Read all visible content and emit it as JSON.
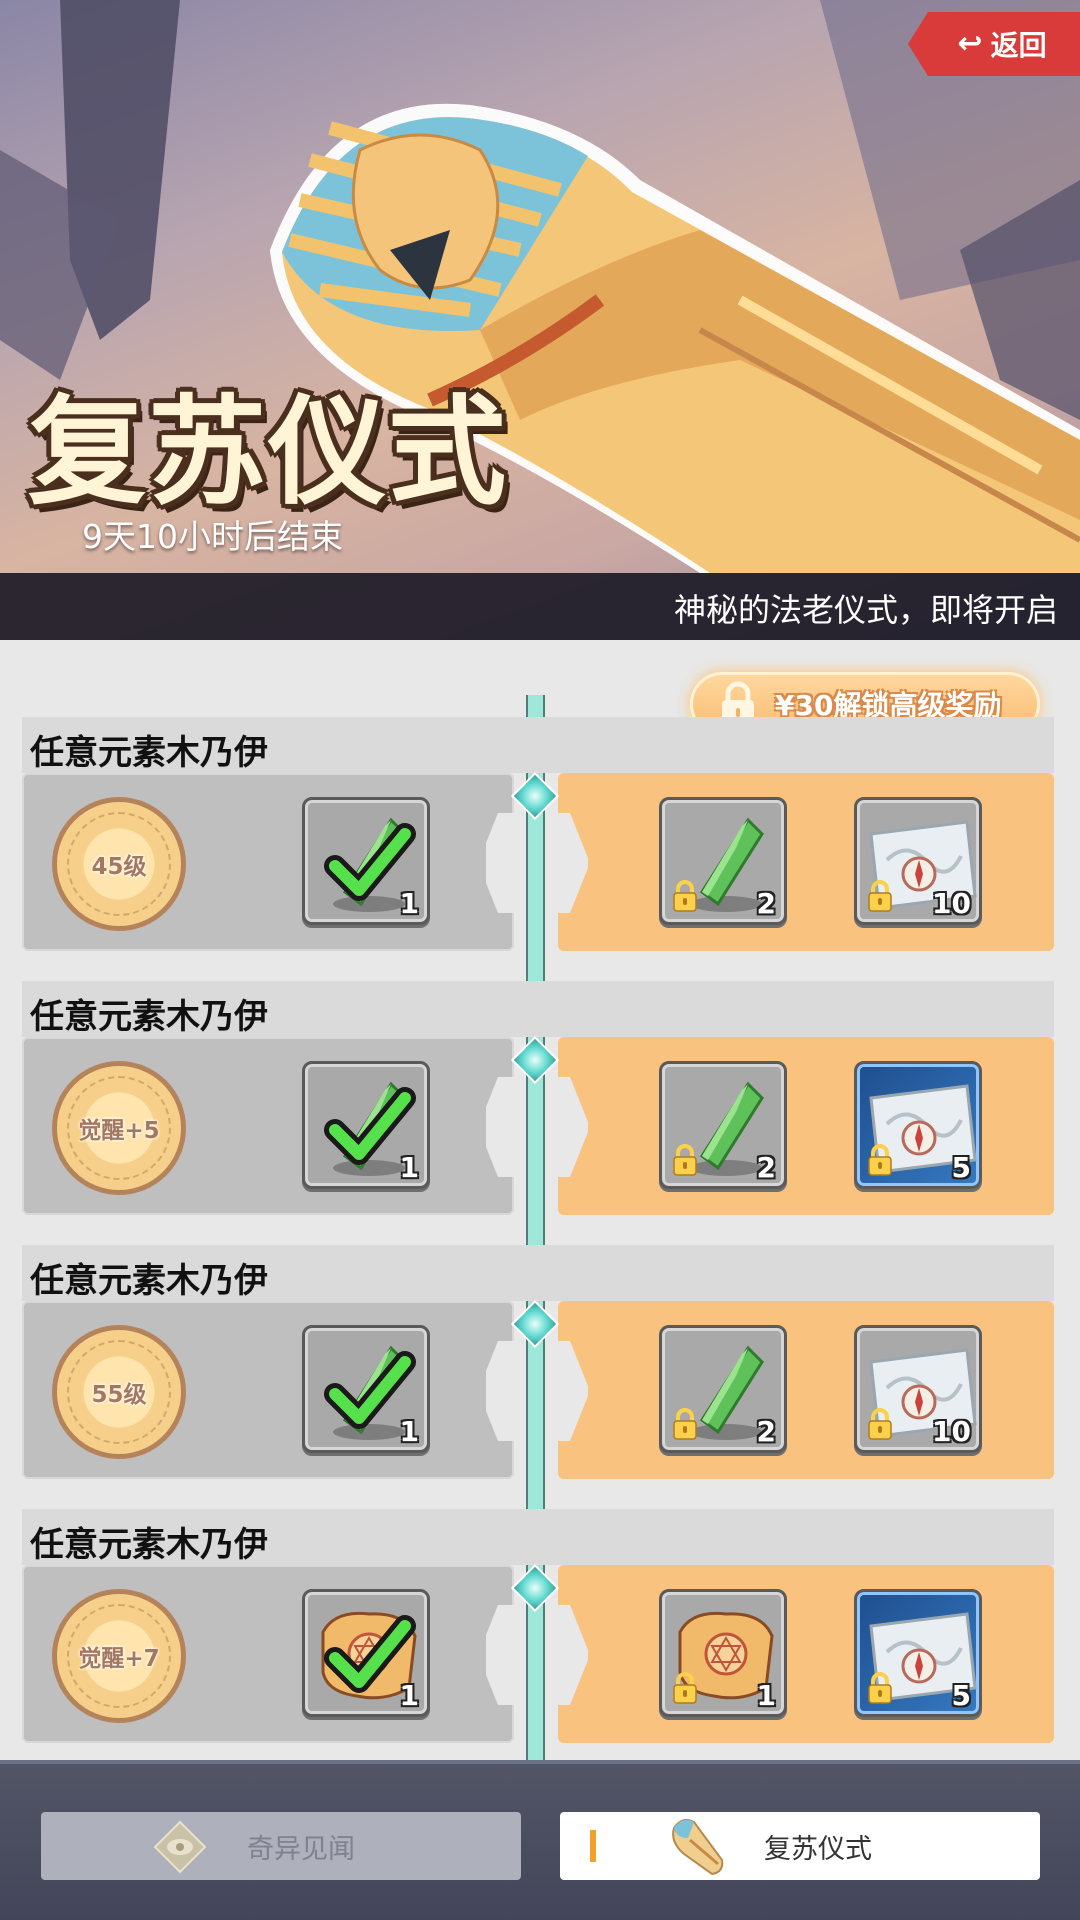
{
  "header": {
    "back_label": "返回",
    "event_title": "复苏仪式",
    "countdown": "9天10小时后结束",
    "description": "神秘的法老仪式，即将开启"
  },
  "unlock": {
    "label": "¥30解锁高级奖励"
  },
  "rows": [
    {
      "title": "任意元素木乃伊",
      "level": "45级",
      "free_reward": {
        "icon": "green-crystal-icon",
        "qty": "1",
        "claimed": true
      },
      "premium_rewards": [
        {
          "icon": "green-crystal-icon",
          "qty": "2",
          "locked": true,
          "frame": "gray"
        },
        {
          "icon": "map-compass-icon",
          "qty": "10",
          "locked": true,
          "frame": "gray"
        }
      ]
    },
    {
      "title": "任意元素木乃伊",
      "level": "觉醒+5",
      "free_reward": {
        "icon": "green-crystal-icon",
        "qty": "1",
        "claimed": true
      },
      "premium_rewards": [
        {
          "icon": "green-crystal-icon",
          "qty": "2",
          "locked": true,
          "frame": "gray"
        },
        {
          "icon": "map-compass-icon",
          "qty": "5",
          "locked": true,
          "frame": "blue"
        }
      ]
    },
    {
      "title": "任意元素木乃伊",
      "level": "55级",
      "free_reward": {
        "icon": "green-crystal-icon",
        "qty": "1",
        "claimed": true
      },
      "premium_rewards": [
        {
          "icon": "green-crystal-icon",
          "qty": "2",
          "locked": true,
          "frame": "gray"
        },
        {
          "icon": "map-compass-icon",
          "qty": "10",
          "locked": true,
          "frame": "gray"
        }
      ]
    },
    {
      "title": "任意元素木乃伊",
      "level": "觉醒+7",
      "free_reward": {
        "icon": "magic-scroll-icon",
        "qty": "1",
        "claimed": true
      },
      "premium_rewards": [
        {
          "icon": "magic-scroll-icon",
          "qty": "1",
          "locked": true,
          "frame": "gray"
        },
        {
          "icon": "map-compass-icon",
          "qty": "5",
          "locked": true,
          "frame": "blue"
        }
      ]
    }
  ],
  "tabs": {
    "inactive_label": "奇异见闻",
    "active_label": "复苏仪式"
  },
  "colors": {
    "accent_red": "#d93a3a",
    "premium_orange": "#f9c27f",
    "track_teal": "#9fe7d9",
    "tab_marker": "#f2a22a"
  }
}
